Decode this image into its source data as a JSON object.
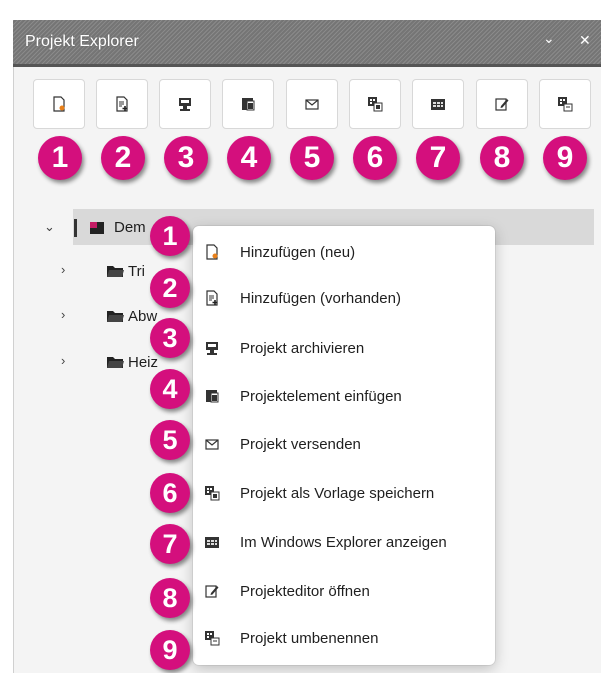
{
  "window": {
    "title": "Projekt Explorer",
    "dropdown_glyph": "⌄",
    "close_glyph": "✕"
  },
  "toolbar": {
    "buttons": [
      {
        "icon": "new-file-icon",
        "badge": "1"
      },
      {
        "icon": "add-existing-icon",
        "badge": "2"
      },
      {
        "icon": "archive-icon",
        "badge": "3"
      },
      {
        "icon": "insert-element-icon",
        "badge": "4"
      },
      {
        "icon": "mail-icon",
        "badge": "5"
      },
      {
        "icon": "save-template-icon",
        "badge": "6"
      },
      {
        "icon": "windows-explorer-icon",
        "badge": "7"
      },
      {
        "icon": "edit-icon",
        "badge": "8"
      },
      {
        "icon": "rename-icon",
        "badge": "9"
      }
    ]
  },
  "tree": {
    "root": {
      "label": "Dem",
      "expanded": true
    },
    "children": [
      {
        "label": "Tri"
      },
      {
        "label": "Abw"
      },
      {
        "label": "Heiz"
      }
    ]
  },
  "context_menu": {
    "items": [
      {
        "badge": "1",
        "label": "Hinzufügen (neu)",
        "icon": "new-file-icon"
      },
      {
        "badge": "2",
        "label": "Hinzufügen (vorhanden)",
        "icon": "add-existing-icon"
      },
      {
        "badge": "3",
        "label": "Projekt archivieren",
        "icon": "archive-icon"
      },
      {
        "badge": "4",
        "label": "Projektelement einfügen",
        "icon": "insert-element-icon"
      },
      {
        "badge": "5",
        "label": "Projekt versenden",
        "icon": "mail-icon"
      },
      {
        "badge": "6",
        "label": "Projekt als Vorlage speichern",
        "icon": "save-template-icon"
      },
      {
        "badge": "7",
        "label": "Im Windows Explorer anzeigen",
        "icon": "windows-explorer-icon"
      },
      {
        "badge": "8",
        "label": "Projekteditor öffnen",
        "icon": "edit-icon"
      },
      {
        "badge": "9",
        "label": "Projekt umbenennen",
        "icon": "rename-icon"
      }
    ]
  },
  "colors": {
    "badge": "#d40f7d",
    "titlebar": "#7a7a7a",
    "selection": "#d9d9d9",
    "project_icon_accent": "#c41b64"
  }
}
